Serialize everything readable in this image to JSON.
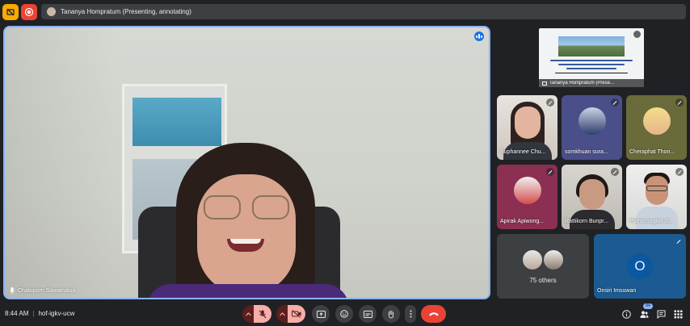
{
  "topbar": {
    "presenter_label": "Tananya Hompratum (Presenting, annotating)"
  },
  "main_video": {
    "name": "Chatuporn Sawatruksa"
  },
  "presentation": {
    "caption": "Tananya Hompratum (Prese..."
  },
  "participants": [
    {
      "name": "Suphannee Chu..."
    },
    {
      "name": "somkhuan sura..."
    },
    {
      "name": "Cheraphat Thon..."
    },
    {
      "name": "Apirak Apiwong..."
    },
    {
      "name": "Rattikorn Bunpr..."
    },
    {
      "name": "Pornmongkol Ji..."
    }
  ],
  "others": {
    "label": "75 others"
  },
  "onsiri": {
    "name": "Onsiri Imsuwan",
    "initial": "O"
  },
  "bottombar": {
    "time": "8:44 AM",
    "separator": "|",
    "meeting_code": "hof-igkv-ucw",
    "people_count": "84"
  },
  "colors": {
    "background": "#202124",
    "accent_blue": "#8ab4f8",
    "end_call_red": "#ea4335",
    "muted_control": "#f6aea9"
  }
}
